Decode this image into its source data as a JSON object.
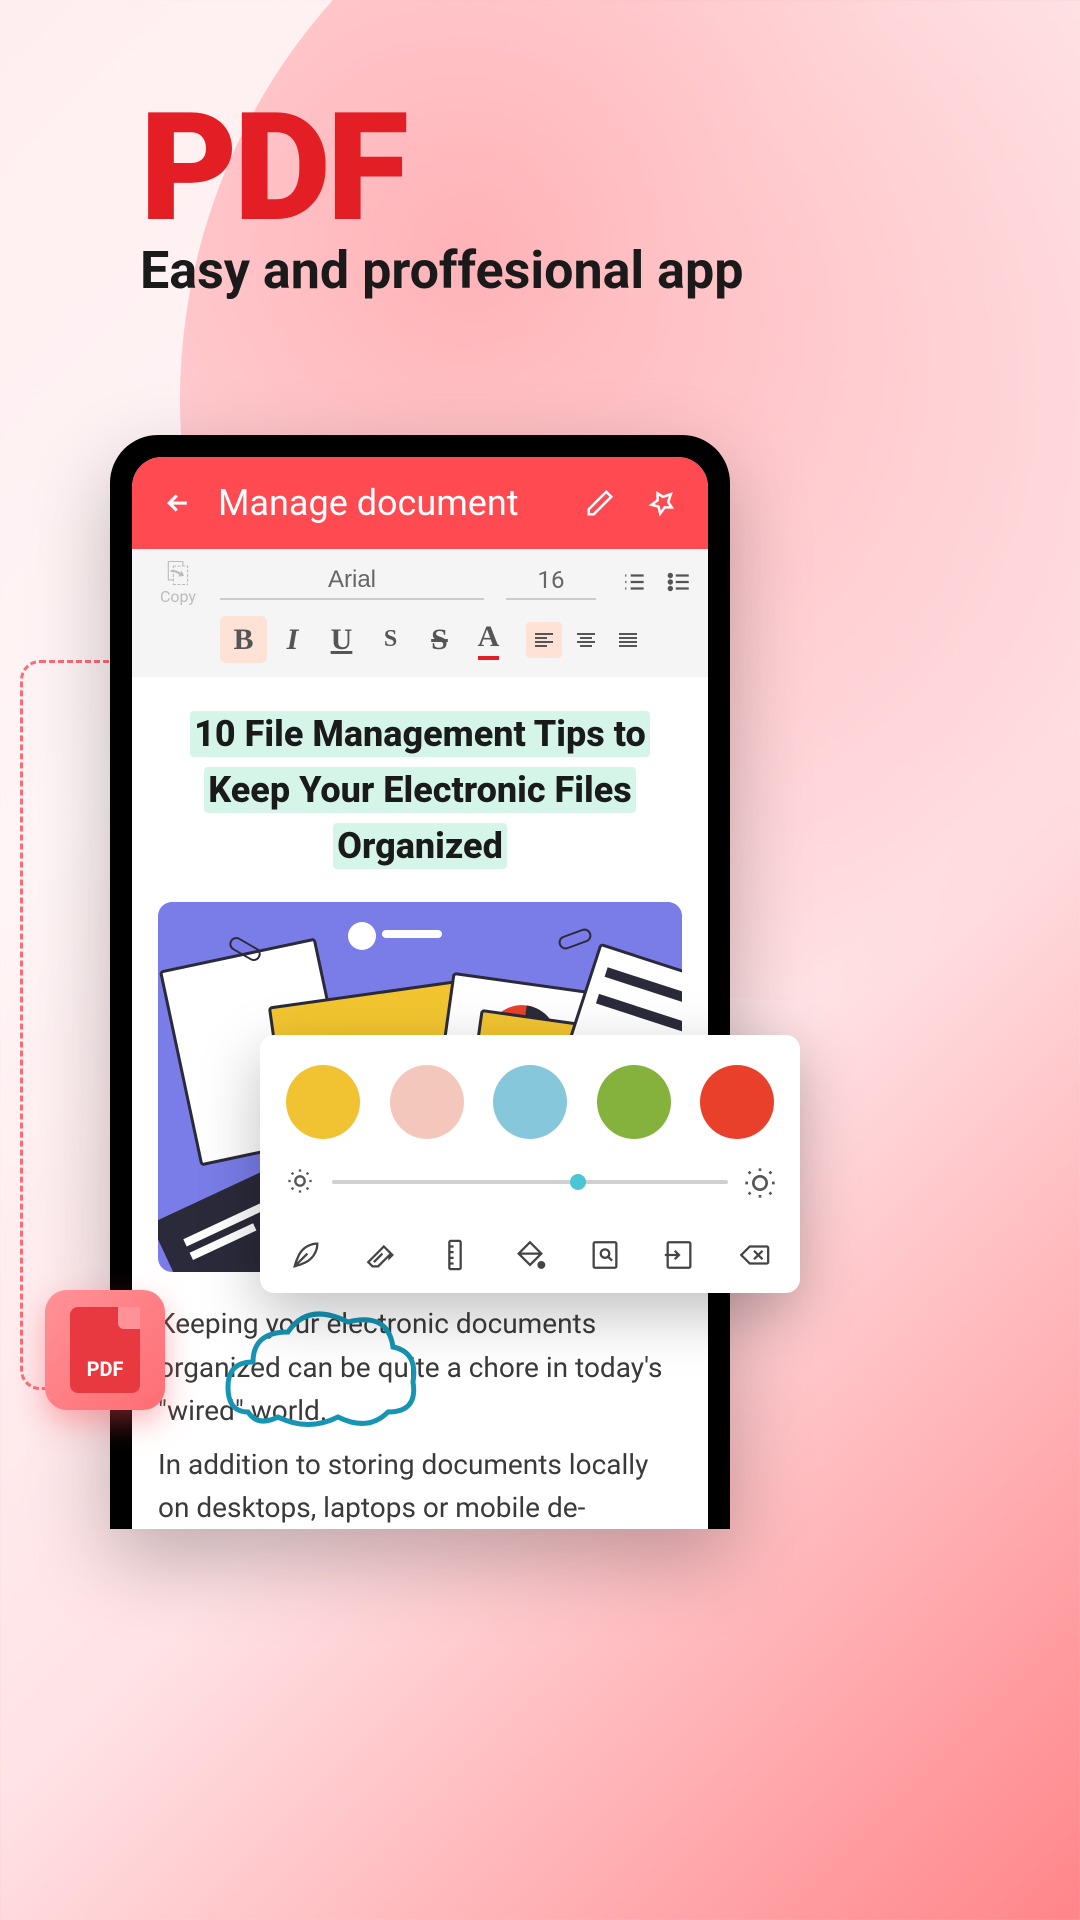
{
  "hero": {
    "title": "PDF",
    "subtitle": "Easy and proffesional app"
  },
  "badge": {
    "label": "PDF"
  },
  "app": {
    "header_title": "Manage document",
    "toolbar": {
      "copy_label": "Copy",
      "font_name": "Arial",
      "font_size": "16",
      "buttons": {
        "bold": "B",
        "italic": "I",
        "underline": "U",
        "small": "S",
        "strike": "S",
        "fontcolor": "A"
      }
    },
    "document": {
      "title_l1": "10 File Management Tips to",
      "title_l2": "Keep Your Electronic Files",
      "title_l3": "Organized",
      "body1": "Keeping your electronic documents organized can be quite a chore in today's \"wired\" world.",
      "body2": "In addition to storing documents locally on desktops, laptops or mobile de-"
    }
  },
  "color_panel": {
    "swatches": [
      "#f1c232",
      "#f4c7bd",
      "#86c7db",
      "#84b23d",
      "#e8402a"
    ]
  }
}
